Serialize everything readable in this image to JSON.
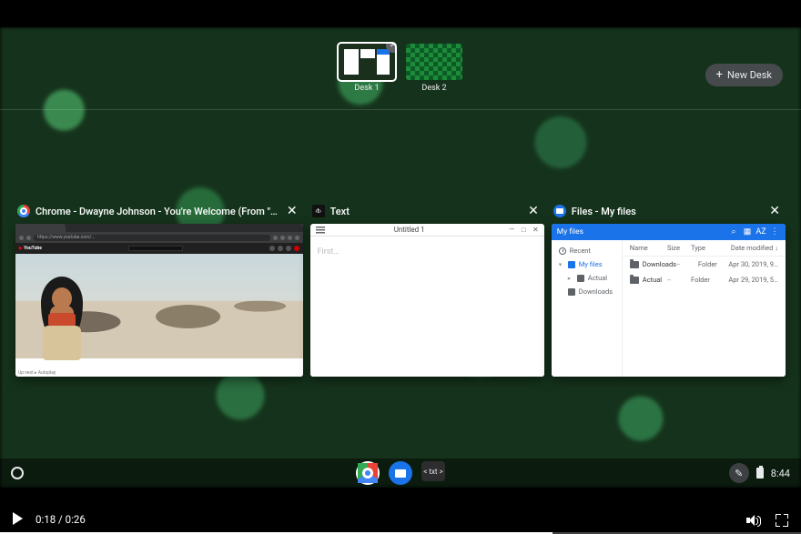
{
  "desks": {
    "items": [
      {
        "label": "Desk 1",
        "active": true
      },
      {
        "label": "Desk 2",
        "active": false
      }
    ],
    "new_label": "New Desk"
  },
  "windows": {
    "chrome": {
      "title": "Chrome - Dwayne Johnson - You're Welcome (From \"…",
      "url_text": "https://www.youtube.com/...",
      "youtube_brand": "YouTube",
      "footer_text": "Up next ▸ Autoplay"
    },
    "text": {
      "title": "Text",
      "doc_title": "Untitled 1",
      "placeholder": "First…"
    },
    "files": {
      "title": "Files - My files",
      "toolbar_title": "My files",
      "sort_label": "AZ",
      "sidebar": [
        {
          "label": "Recent",
          "icon": "clock"
        },
        {
          "label": "My files",
          "icon": "sq",
          "active": true,
          "expandable": true
        },
        {
          "label": "Actual",
          "icon": "fold",
          "indent": true,
          "expandable": true
        },
        {
          "label": "Downloads",
          "icon": "fold",
          "indent": true
        }
      ],
      "columns": {
        "name": "Name",
        "size": "Size",
        "type": "Type",
        "date": "Date modified ↓"
      },
      "rows": [
        {
          "name": "Downloads",
          "size": "--",
          "type": "Folder",
          "date": "Apr 30, 2019, 9…"
        },
        {
          "name": "Actual",
          "size": "--",
          "type": "Folder",
          "date": "Apr 29, 2019, 5…"
        }
      ]
    }
  },
  "shelf": {
    "txt_label": "< txt >",
    "clock": "8:44"
  },
  "player": {
    "current": "0:18",
    "total": "0:26",
    "progress_pct": 69
  }
}
